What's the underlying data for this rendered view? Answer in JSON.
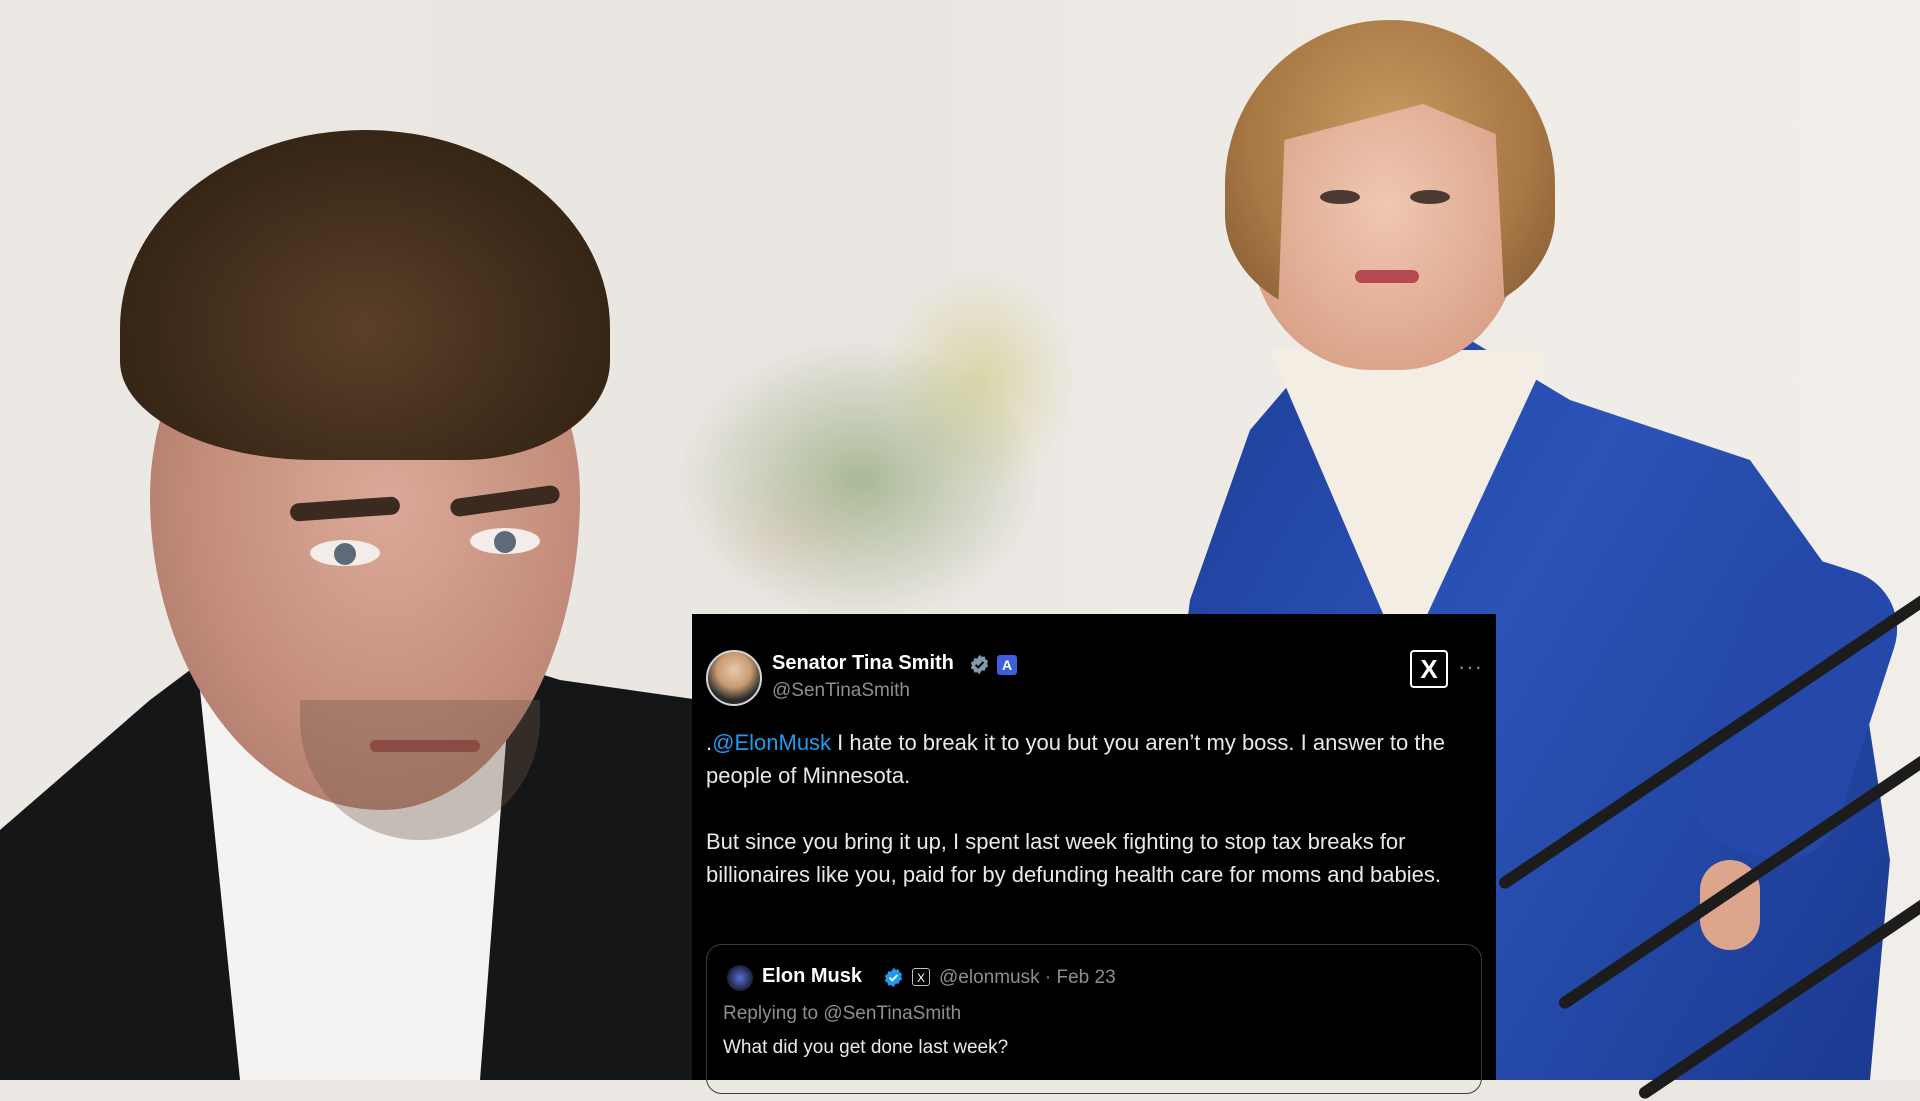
{
  "tweet": {
    "author_name": "Senator Tina Smith",
    "author_handle": "@SenTinaSmith",
    "gov_badge": "A",
    "x_logo": "X",
    "more": "···",
    "body": {
      "line1_prefix": ".",
      "mention": "@ElonMusk",
      "line1_rest": " I hate to break it to you but you aren’t my boss. I answer to the people of Minnesota.",
      "paragraph2": "But since you bring it up, I spent last week fighting to stop tax breaks for billionaires like you, paid for by defunding health care for moms and babies."
    },
    "quoted": {
      "author_name": "Elon Musk",
      "x_badge": "X",
      "handle_date": "@elonmusk · Feb 23",
      "replying_to": "Replying to @SenTinaSmith",
      "text": "What did you get done last week?"
    },
    "colors": {
      "card_bg": "#000000",
      "mention": "#1d9bf0",
      "verified_blue": "#1d9bf0",
      "verified_gray": "#829aab",
      "gov_badge": "#3a5fd8"
    },
    "icons": [
      "verified-gray-icon",
      "government-badge-icon",
      "x-logo-icon",
      "more-icon",
      "verified-blue-icon",
      "x-affiliation-icon"
    ]
  },
  "background": {
    "left_photo": "man-portrait",
    "right_photo": "woman-portrait",
    "jacket_color": "#2b53b8"
  }
}
